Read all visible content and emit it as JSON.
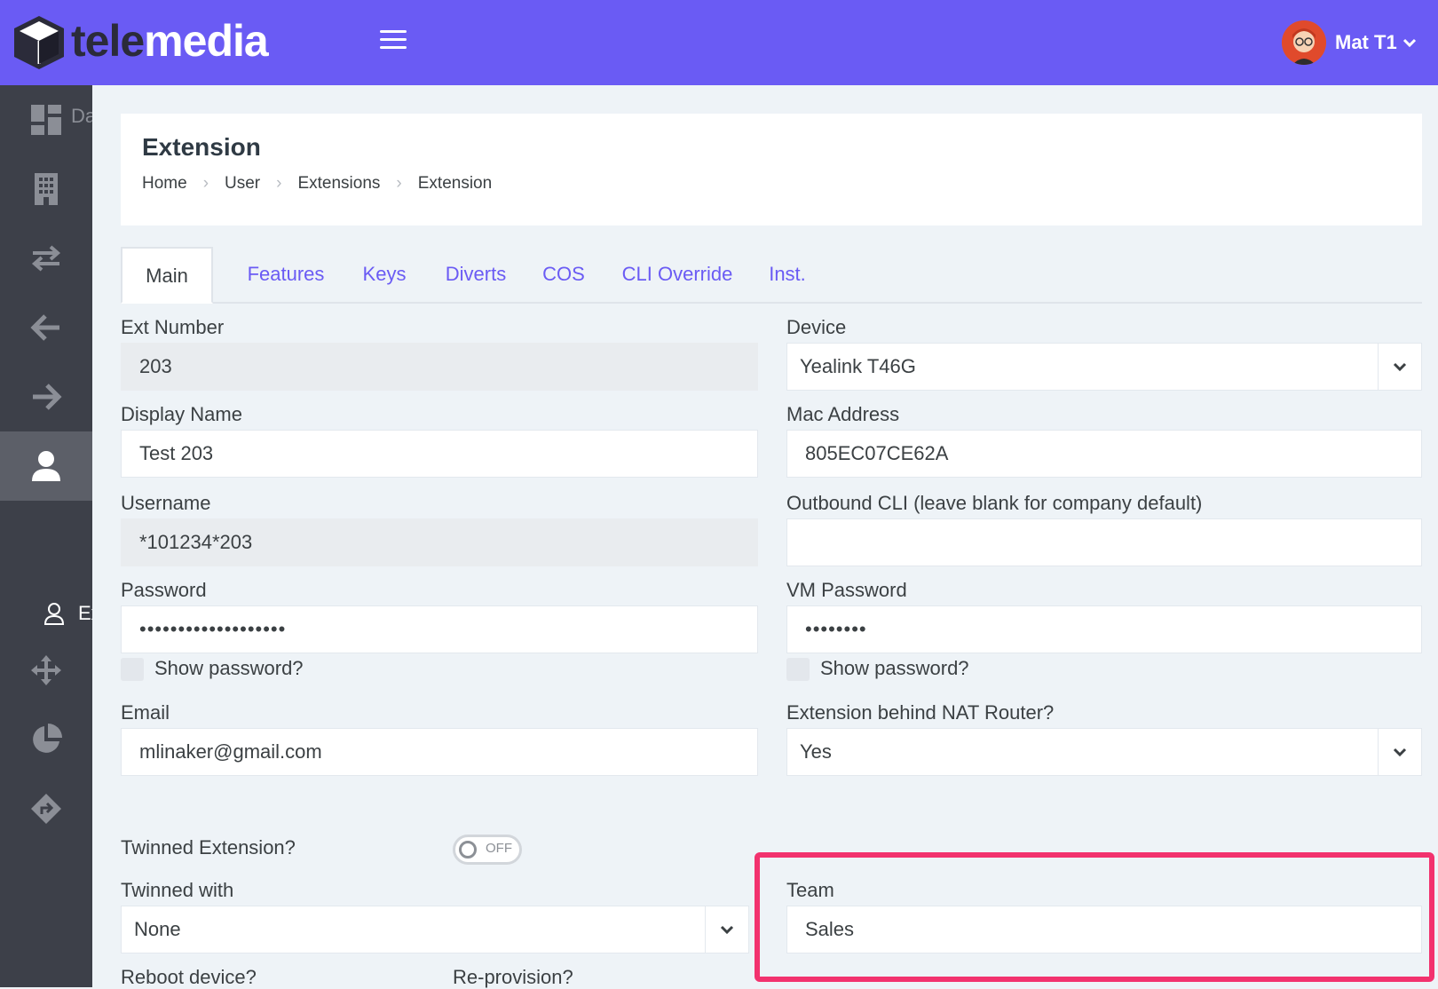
{
  "header": {
    "logo_part1": "tele",
    "logo_part2": "media",
    "user_name": "Mat T1"
  },
  "sidebar": {
    "items": [
      {
        "icon": "dashboard-icon",
        "label_clip": "Da"
      },
      {
        "icon": "building-icon"
      },
      {
        "icon": "transfer-arrows-icon"
      },
      {
        "icon": "arrow-left-icon"
      },
      {
        "icon": "arrow-right-icon"
      },
      {
        "icon": "user-icon"
      },
      {
        "icon": "move-arrows-icon"
      },
      {
        "icon": "pie-chart-icon"
      },
      {
        "icon": "route-diamond-icon"
      }
    ],
    "sub_item": {
      "icon": "user-outline-icon",
      "label_clip": "Ex"
    }
  },
  "page": {
    "title": "Extension",
    "breadcrumb": [
      "Home",
      "User",
      "Extensions",
      "Extension"
    ]
  },
  "tabs": [
    "Main",
    "Features",
    "Keys",
    "Diverts",
    "COS",
    "CLI Override",
    "Inst."
  ],
  "form": {
    "ext_number": {
      "label": "Ext Number",
      "value": "203"
    },
    "device": {
      "label": "Device",
      "value": "Yealink T46G"
    },
    "display_name": {
      "label": "Display Name",
      "value": "Test 203"
    },
    "mac_address": {
      "label": "Mac Address",
      "value": "805EC07CE62A"
    },
    "username": {
      "label": "Username",
      "value": "*101234*203"
    },
    "outbound_cli": {
      "label": "Outbound CLI (leave blank for company default)",
      "value": ""
    },
    "password": {
      "label": "Password",
      "value": "•••••••••••••••••••"
    },
    "vm_password": {
      "label": "VM Password",
      "value": "••••••••"
    },
    "show_password_label": "Show password?",
    "email": {
      "label": "Email",
      "value": "mlinaker@gmail.com"
    },
    "nat_router": {
      "label": "Extension behind NAT Router?",
      "value": "Yes"
    },
    "twinned_extension": {
      "label": "Twinned Extension?",
      "toggle_text": "OFF"
    },
    "twinned_with": {
      "label": "Twinned with",
      "value": "None"
    },
    "team": {
      "label": "Team",
      "value": "Sales"
    },
    "reboot_device": {
      "label": "Reboot device?"
    },
    "reprovision": {
      "label": "Re-provision?"
    }
  },
  "colors": {
    "brand": "#6a5bf4",
    "sidebar": "#3d4049",
    "highlight": "#f2326e"
  }
}
